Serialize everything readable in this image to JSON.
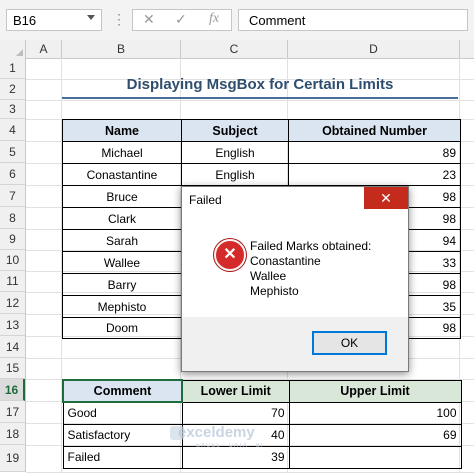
{
  "formula_bar": {
    "name_box": "B16",
    "cancel_icon": "✕",
    "enter_icon": "✓",
    "fx_label": "fx",
    "formula": "Comment"
  },
  "columns": [
    "A",
    "B",
    "C",
    "D"
  ],
  "rows": [
    "1",
    "2",
    "3",
    "4",
    "5",
    "6",
    "7",
    "8",
    "9",
    "10",
    "11",
    "12",
    "13",
    "14",
    "15",
    "16",
    "17",
    "18",
    "19"
  ],
  "title": "Displaying MsgBox for Certain Limits",
  "marks_table": {
    "headers": [
      "Name",
      "Subject",
      "Obtained Number"
    ],
    "rows": [
      [
        "Michael",
        "English",
        "89"
      ],
      [
        "Conastantine",
        "English",
        "23"
      ],
      [
        "Bruce",
        "",
        "98"
      ],
      [
        "Clark",
        "",
        "98"
      ],
      [
        "Sarah",
        "",
        "94"
      ],
      [
        "Wallee",
        "",
        "33"
      ],
      [
        "Barry",
        "",
        "98"
      ],
      [
        "Mephisto",
        "",
        "35"
      ],
      [
        "Doom",
        "",
        "98"
      ]
    ]
  },
  "limits_table": {
    "headers": [
      "Comment",
      "Lower  Limit",
      "Upper Limit"
    ],
    "rows": [
      [
        "Good",
        "70",
        "100"
      ],
      [
        "Satisfactory",
        "40",
        "69"
      ],
      [
        "Failed",
        "39",
        ""
      ]
    ]
  },
  "dialog": {
    "title": "Failed",
    "close": "✕",
    "message": "Failed Marks obtained:\nConastantine\nWallee\nMephisto",
    "ok": "OK",
    "icon": "error-icon",
    "accent": "#0078d7"
  },
  "watermark": {
    "name": "exceldemy",
    "sub": "EXCEL · DATA · BI"
  }
}
